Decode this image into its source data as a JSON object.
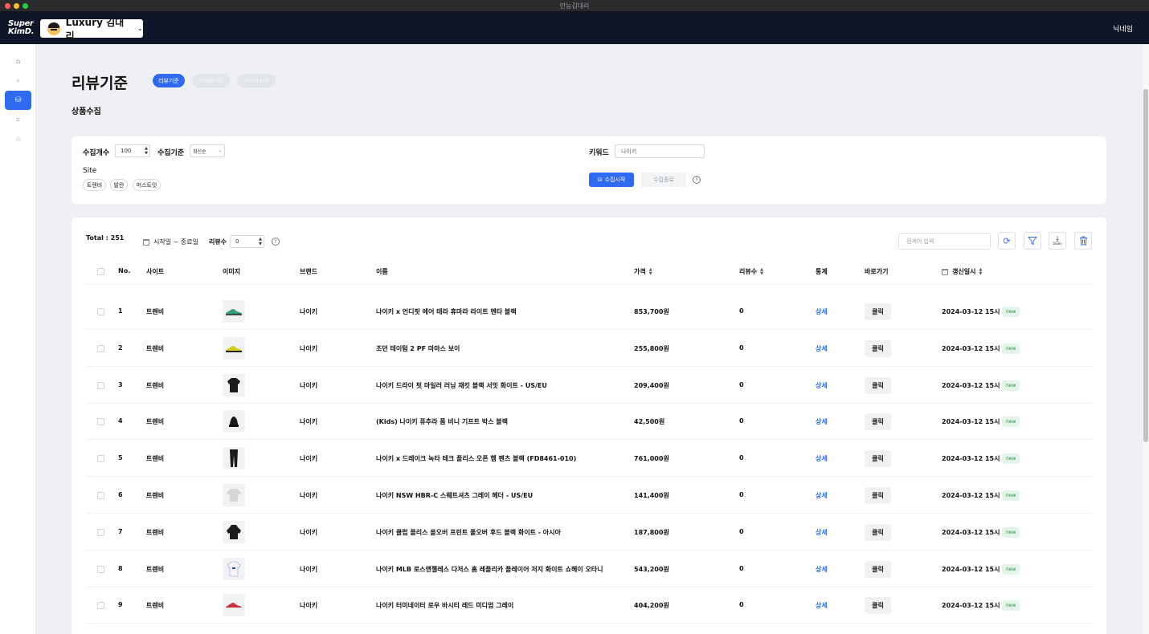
{
  "window": {
    "title": "만능김대리"
  },
  "header": {
    "logo_line1": "Super",
    "logo_line2": "KimD.",
    "account_name": "Luxury 김대리",
    "nickname": "닉네임"
  },
  "sidebar": {
    "items": [
      {
        "icon": "home-icon",
        "glyph": "⌂"
      },
      {
        "icon": "search-icon",
        "glyph": "⌕"
      },
      {
        "icon": "collect-icon",
        "glyph": "⛁",
        "active": true
      },
      {
        "icon": "tag-icon",
        "glyph": "⌗"
      },
      {
        "icon": "star-icon",
        "glyph": "☆"
      }
    ]
  },
  "page": {
    "title": "리뷰기준",
    "tabs": [
      "리뷰기준",
      "거래량기준",
      "최저가찾기"
    ],
    "section_title": "상품수집"
  },
  "filters": {
    "count_label": "수집개수",
    "count_value": "100",
    "criteria_label": "수집기준",
    "criteria_value": "최신순",
    "site_label": "Site",
    "sites": [
      "트렌비",
      "발란",
      "머스트잇"
    ],
    "keyword_label": "키워드",
    "keyword_value": "나이키",
    "start_button": "수집시작",
    "stop_button": "수집종료",
    "help": "?"
  },
  "table_toolbar": {
    "total": "Total : 251",
    "date_range": "시작일 ~ 종료일",
    "review_count_label": "리뷰수",
    "review_count_value": "0",
    "search_placeholder": "검색어 입력",
    "down_label": "Down"
  },
  "table": {
    "headers": [
      "No.",
      "사이트",
      "이미지",
      "브랜드",
      "이름",
      "가격",
      "리뷰수",
      "통계",
      "바로가기",
      "갱신일시"
    ],
    "rows": [
      {
        "no": "1",
        "site": "트렌비",
        "image": "sneaker-green",
        "brand": "나이키",
        "name": "나이키 x 언디핏 에어 테라 휴마라 라이트 멘타 블랙",
        "price": "853,700원",
        "reviews": "0",
        "stats": "상세",
        "goto": "클릭",
        "updated": "2024-03-12 15시",
        "badge": "new"
      },
      {
        "no": "2",
        "site": "트렌비",
        "image": "sneaker-yellow",
        "brand": "나이키",
        "name": "조던 테이텀 2 PF 마마스 보이",
        "price": "255,800원",
        "reviews": "0",
        "stats": "상세",
        "goto": "클릭",
        "updated": "2024-03-12 15시",
        "badge": "new"
      },
      {
        "no": "3",
        "site": "트렌비",
        "image": "jacket-black",
        "brand": "나이키",
        "name": "나이키 드라이 핏 마일러 러닝 재킷 블랙 서밋 화이트 - US/EU",
        "price": "209,400원",
        "reviews": "0",
        "stats": "상세",
        "goto": "클릭",
        "updated": "2024-03-12 15시",
        "badge": "new"
      },
      {
        "no": "4",
        "site": "트렌비",
        "image": "beanie-black",
        "brand": "나이키",
        "name": "(Kids) 나이키 퓨추라 폼 비니 기프트 박스 블랙",
        "price": "42,500원",
        "reviews": "0",
        "stats": "상세",
        "goto": "클릭",
        "updated": "2024-03-12 15시",
        "badge": "new"
      },
      {
        "no": "5",
        "site": "트렌비",
        "image": "pants-black",
        "brand": "나이키",
        "name": "나이키 x 드레이크 녹타 테크 플리스 오픈 헴 팬츠 블랙 (FD8461-010)",
        "price": "761,000원",
        "reviews": "0",
        "stats": "상세",
        "goto": "클릭",
        "updated": "2024-03-12 15시",
        "badge": "new"
      },
      {
        "no": "6",
        "site": "트렌비",
        "image": "sweatshirt-grey",
        "brand": "나이키",
        "name": "나이키 NSW HBR-C 스웨트셔츠 그레이 헤더 - US/EU",
        "price": "141,400원",
        "reviews": "0",
        "stats": "상세",
        "goto": "클릭",
        "updated": "2024-03-12 15시",
        "badge": "new"
      },
      {
        "no": "7",
        "site": "트렌비",
        "image": "hoodie-black",
        "brand": "나이키",
        "name": "나이키 클럽 플리스 올오버 프린트 풀오버 후드 블랙 화이트 - 아시아",
        "price": "187,800원",
        "reviews": "0",
        "stats": "상세",
        "goto": "클릭",
        "updated": "2024-03-12 15시",
        "badge": "new"
      },
      {
        "no": "8",
        "site": "트렌비",
        "image": "jersey-white",
        "brand": "나이키",
        "name": "나이키 MLB 로스앤젤레스 다저스 홈 레플리카 플레이어 저지 화이트 쇼헤이 오타니",
        "price": "543,200원",
        "reviews": "0",
        "stats": "상세",
        "goto": "클릭",
        "updated": "2024-03-12 15시",
        "badge": "new"
      },
      {
        "no": "9",
        "site": "트렌비",
        "image": "sneaker-red",
        "brand": "나이키",
        "name": "나이키 터미네이터 로우 바시티 레드 미디엄 그레이",
        "price": "404,200원",
        "reviews": "0",
        "stats": "상세",
        "goto": "클릭",
        "updated": "2024-03-12 15시",
        "badge": "new"
      }
    ]
  },
  "colors": {
    "accent": "#2f6bf0",
    "header_bg": "#0e1628",
    "badge_bg": "#e3f5e8",
    "badge_text": "#2f8a4a"
  }
}
